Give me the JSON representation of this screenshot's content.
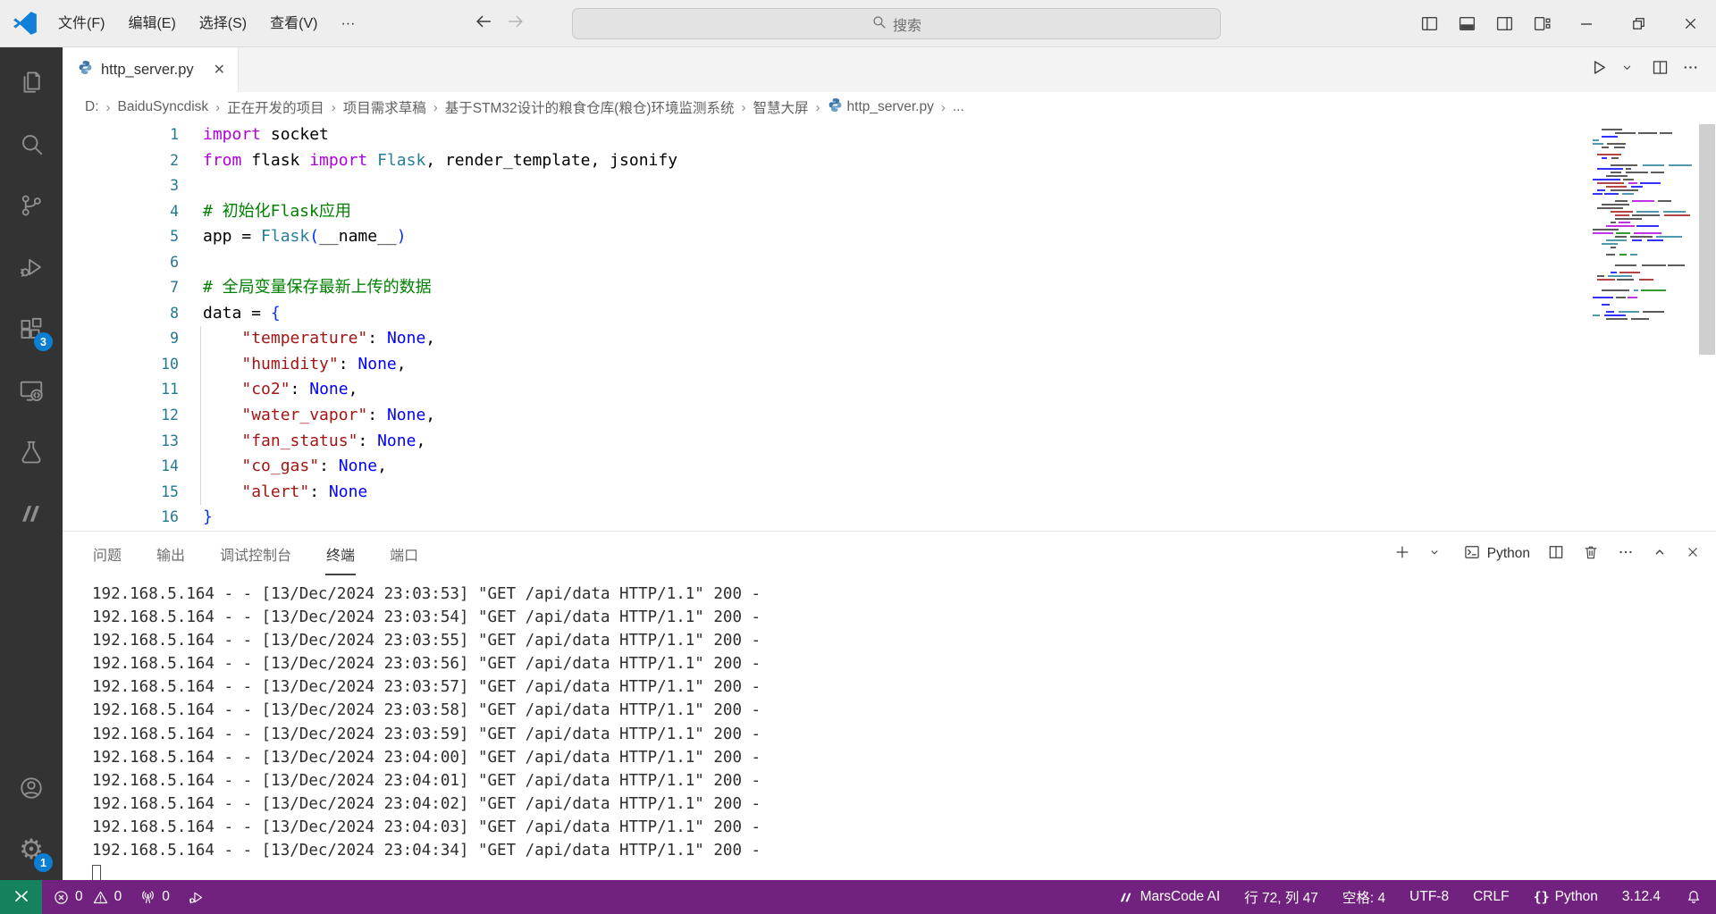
{
  "window": {
    "menus": [
      {
        "name": "file",
        "label": "文件(F)"
      },
      {
        "name": "edit",
        "label": "编辑(E)"
      },
      {
        "name": "selection",
        "label": "选择(S)"
      },
      {
        "name": "view",
        "label": "查看(V)"
      },
      {
        "name": "more",
        "label": "···"
      }
    ],
    "search_label": "搜索"
  },
  "activity_bar": {
    "items": [
      {
        "name": "explorer",
        "icon": "files-icon"
      },
      {
        "name": "search",
        "icon": "search-icon"
      },
      {
        "name": "source-control",
        "icon": "source-control-icon"
      },
      {
        "name": "run-debug",
        "icon": "run-debug-icon"
      },
      {
        "name": "extensions",
        "icon": "extensions-icon",
        "badge": "3"
      },
      {
        "name": "remote-explorer",
        "icon": "remote-explorer-icon"
      },
      {
        "name": "testing",
        "icon": "testing-icon"
      },
      {
        "name": "marscode",
        "icon": "marscode-icon"
      }
    ],
    "bottom_items": [
      {
        "name": "account",
        "icon": "account-icon"
      },
      {
        "name": "settings",
        "icon": "settings-gear-icon",
        "badge": "1"
      }
    ]
  },
  "editor": {
    "tab": {
      "label": "http_server.py"
    },
    "breadcrumb": [
      {
        "label": "D:"
      },
      {
        "label": "BaiduSyncdisk"
      },
      {
        "label": "正在开发的项目"
      },
      {
        "label": "项目需求草稿"
      },
      {
        "label": "基于STM32设计的粮食仓库(粮仓)环境监测系统"
      },
      {
        "label": "智慧大屏"
      },
      {
        "label": "http_server.py",
        "icon": "python-icon"
      },
      {
        "label": "..."
      }
    ],
    "lines": [
      {
        "n": "1",
        "t": [
          [
            "import",
            "kw"
          ],
          [
            " socket",
            "pl"
          ]
        ]
      },
      {
        "n": "2",
        "t": [
          [
            "from",
            "kw"
          ],
          [
            " flask ",
            "pl"
          ],
          [
            "import",
            "kw"
          ],
          [
            " ",
            "pl"
          ],
          [
            "Flask",
            "cls"
          ],
          [
            ", render_template, jsonify",
            "pl"
          ]
        ]
      },
      {
        "n": "3",
        "t": []
      },
      {
        "n": "4",
        "t": [
          [
            "# 初始化Flask应用",
            "cm"
          ]
        ]
      },
      {
        "n": "5",
        "t": [
          [
            "app = ",
            "pl"
          ],
          [
            "Flask",
            "cls"
          ],
          [
            "(",
            "br"
          ],
          [
            "__name__",
            "pl"
          ],
          [
            ")",
            "br"
          ]
        ]
      },
      {
        "n": "6",
        "t": []
      },
      {
        "n": "7",
        "t": [
          [
            "# 全局变量保存最新上传的数据",
            "cm"
          ]
        ]
      },
      {
        "n": "8",
        "t": [
          [
            "data = ",
            "pl"
          ],
          [
            "{",
            "br"
          ]
        ]
      },
      {
        "n": "9",
        "g": true,
        "t": [
          [
            "    ",
            "pl"
          ],
          [
            "\"temperature\"",
            "str"
          ],
          [
            ": ",
            "pl"
          ],
          [
            "None",
            "kc"
          ],
          [
            ",",
            "pl"
          ]
        ]
      },
      {
        "n": "10",
        "g": true,
        "t": [
          [
            "    ",
            "pl"
          ],
          [
            "\"humidity\"",
            "str"
          ],
          [
            ": ",
            "pl"
          ],
          [
            "None",
            "kc"
          ],
          [
            ",",
            "pl"
          ]
        ]
      },
      {
        "n": "11",
        "g": true,
        "t": [
          [
            "    ",
            "pl"
          ],
          [
            "\"co2\"",
            "str"
          ],
          [
            ": ",
            "pl"
          ],
          [
            "None",
            "kc"
          ],
          [
            ",",
            "pl"
          ]
        ]
      },
      {
        "n": "12",
        "g": true,
        "t": [
          [
            "    ",
            "pl"
          ],
          [
            "\"water_vapor\"",
            "str"
          ],
          [
            ": ",
            "pl"
          ],
          [
            "None",
            "kc"
          ],
          [
            ",",
            "pl"
          ]
        ]
      },
      {
        "n": "13",
        "g": true,
        "t": [
          [
            "    ",
            "pl"
          ],
          [
            "\"fan_status\"",
            "str"
          ],
          [
            ": ",
            "pl"
          ],
          [
            "None",
            "kc"
          ],
          [
            ",",
            "pl"
          ]
        ]
      },
      {
        "n": "14",
        "g": true,
        "t": [
          [
            "    ",
            "pl"
          ],
          [
            "\"co_gas\"",
            "str"
          ],
          [
            ": ",
            "pl"
          ],
          [
            "None",
            "kc"
          ],
          [
            ",",
            "pl"
          ]
        ]
      },
      {
        "n": "15",
        "g": true,
        "t": [
          [
            "    ",
            "pl"
          ],
          [
            "\"alert\"",
            "str"
          ],
          [
            ": ",
            "pl"
          ],
          [
            "None",
            "kc"
          ]
        ]
      },
      {
        "n": "16",
        "t": [
          [
            "}",
            "br"
          ]
        ]
      }
    ]
  },
  "panel": {
    "tabs": [
      {
        "name": "problems",
        "label": "问题"
      },
      {
        "name": "output",
        "label": "输出"
      },
      {
        "name": "debug-console",
        "label": "调试控制台"
      },
      {
        "name": "terminal",
        "label": "终端"
      },
      {
        "name": "ports",
        "label": "端口"
      }
    ],
    "active_tab": "终端",
    "shell_label": "Python",
    "terminal_lines": [
      "192.168.5.164 - - [13/Dec/2024 23:03:53] \"GET /api/data HTTP/1.1\" 200 -",
      "192.168.5.164 - - [13/Dec/2024 23:03:54] \"GET /api/data HTTP/1.1\" 200 -",
      "192.168.5.164 - - [13/Dec/2024 23:03:55] \"GET /api/data HTTP/1.1\" 200 -",
      "192.168.5.164 - - [13/Dec/2024 23:03:56] \"GET /api/data HTTP/1.1\" 200 -",
      "192.168.5.164 - - [13/Dec/2024 23:03:57] \"GET /api/data HTTP/1.1\" 200 -",
      "192.168.5.164 - - [13/Dec/2024 23:03:58] \"GET /api/data HTTP/1.1\" 200 -",
      "192.168.5.164 - - [13/Dec/2024 23:03:59] \"GET /api/data HTTP/1.1\" 200 -",
      "192.168.5.164 - - [13/Dec/2024 23:04:00] \"GET /api/data HTTP/1.1\" 200 -",
      "192.168.5.164 - - [13/Dec/2024 23:04:01] \"GET /api/data HTTP/1.1\" 200 -",
      "192.168.5.164 - - [13/Dec/2024 23:04:02] \"GET /api/data HTTP/1.1\" 200 -",
      "192.168.5.164 - - [13/Dec/2024 23:04:03] \"GET /api/data HTTP/1.1\" 200 -",
      "192.168.5.164 - - [13/Dec/2024 23:04:34] \"GET /api/data HTTP/1.1\" 200 -"
    ]
  },
  "status_bar": {
    "left_items": [
      {
        "name": "problems-errors",
        "icon": "error-icon",
        "label": "0"
      },
      {
        "name": "problems-warnings",
        "icon": "warning-icon",
        "label": "0"
      },
      {
        "name": "forwarded-ports",
        "icon": "broadcast-icon",
        "label": "0"
      },
      {
        "name": "debug-launch",
        "icon": "debug-status-icon"
      }
    ],
    "right_items": [
      {
        "name": "marscode-ai",
        "icon": "marscode-logo-icon",
        "label": "MarsCode AI"
      },
      {
        "name": "cursor-position",
        "label": "行 72, 列 47"
      },
      {
        "name": "indentation",
        "label": "空格: 4"
      },
      {
        "name": "encoding",
        "label": "UTF-8"
      },
      {
        "name": "eol",
        "label": "CRLF"
      },
      {
        "name": "language-mode",
        "icon": "braces-icon",
        "label": "Python"
      },
      {
        "name": "python-version",
        "label": "3.12.4"
      },
      {
        "name": "notifications",
        "icon": "bell-icon"
      }
    ]
  },
  "colors": {
    "accent": "#0a7fd4",
    "status_purple": "#71227e",
    "remote_green": "#16825d",
    "activity_bg": "#333333"
  }
}
